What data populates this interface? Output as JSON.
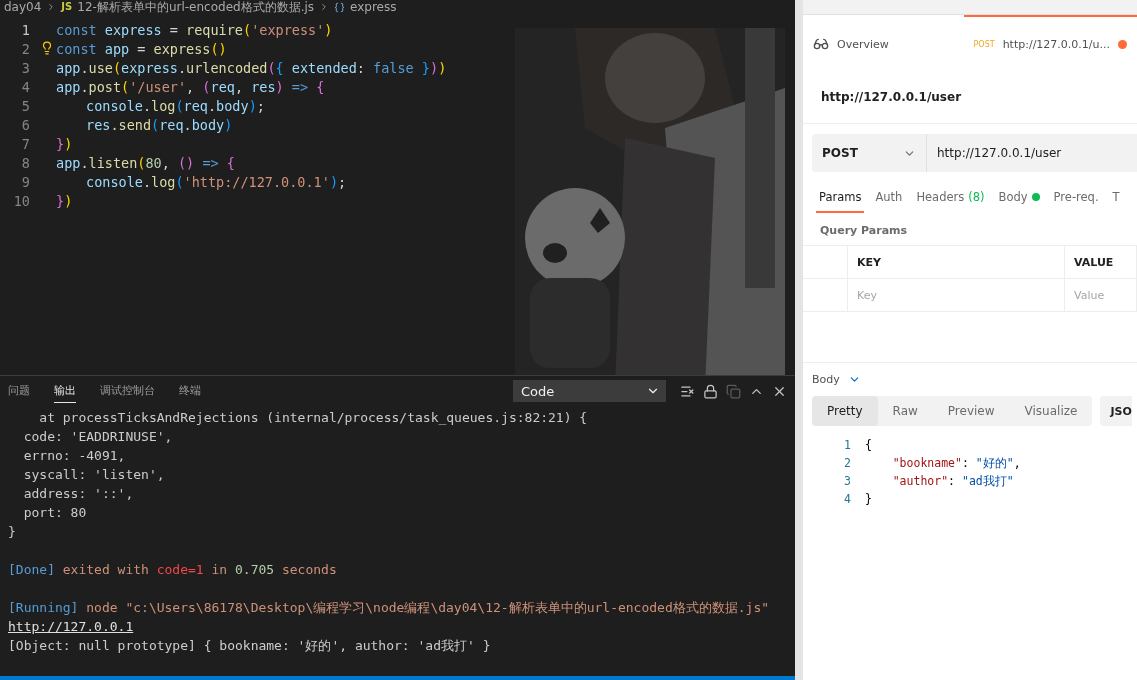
{
  "editor": {
    "breadcrumb": {
      "folder": "day04",
      "file_icon": "JS",
      "file": "12-解析表单中的url-encoded格式的数据.js",
      "symbol": "express"
    },
    "lines": [
      {
        "number": "1",
        "tokens": [
          {
            "text": "const ",
            "kind": "keyword"
          },
          {
            "text": "express",
            "kind": "var"
          },
          {
            "text": " = ",
            "kind": "plain"
          },
          {
            "text": "require",
            "kind": "fn"
          },
          {
            "text": "(",
            "kind": "paren1"
          },
          {
            "text": "'express'",
            "kind": "string"
          },
          {
            "text": ")",
            "kind": "paren1"
          }
        ]
      },
      {
        "number": "2",
        "tokens": [
          {
            "text": "const ",
            "kind": "keyword"
          },
          {
            "text": "app",
            "kind": "var"
          },
          {
            "text": " = ",
            "kind": "plain"
          },
          {
            "text": "express",
            "kind": "fn"
          },
          {
            "text": "()",
            "kind": "paren1"
          }
        ]
      },
      {
        "number": "3",
        "tokens": [
          {
            "text": "app",
            "kind": "var"
          },
          {
            "text": ".",
            "kind": "plain"
          },
          {
            "text": "use",
            "kind": "fn"
          },
          {
            "text": "(",
            "kind": "paren1"
          },
          {
            "text": "express",
            "kind": "var"
          },
          {
            "text": ".",
            "kind": "plain"
          },
          {
            "text": "urlencoded",
            "kind": "fn"
          },
          {
            "text": "(",
            "kind": "paren2"
          },
          {
            "text": "{ ",
            "kind": "paren3"
          },
          {
            "text": "extended",
            "kind": "var"
          },
          {
            "text": ": ",
            "kind": "plain"
          },
          {
            "text": "false",
            "kind": "keyword"
          },
          {
            "text": " }",
            "kind": "paren3"
          },
          {
            "text": ")",
            "kind": "paren2"
          },
          {
            "text": ")",
            "kind": "paren1"
          }
        ]
      },
      {
        "number": "4",
        "tokens": [
          {
            "text": "app",
            "kind": "var"
          },
          {
            "text": ".",
            "kind": "plain"
          },
          {
            "text": "post",
            "kind": "fn"
          },
          {
            "text": "(",
            "kind": "paren1"
          },
          {
            "text": "'/user'",
            "kind": "string"
          },
          {
            "text": ", ",
            "kind": "plain"
          },
          {
            "text": "(",
            "kind": "paren2"
          },
          {
            "text": "req",
            "kind": "var"
          },
          {
            "text": ", ",
            "kind": "plain"
          },
          {
            "text": "res",
            "kind": "var"
          },
          {
            "text": ")",
            "kind": "paren2"
          },
          {
            "text": " => ",
            "kind": "keyword"
          },
          {
            "text": "{",
            "kind": "paren2"
          }
        ]
      },
      {
        "number": "5",
        "indent": true,
        "tokens": [
          {
            "text": "console",
            "kind": "var"
          },
          {
            "text": ".",
            "kind": "plain"
          },
          {
            "text": "log",
            "kind": "fn"
          },
          {
            "text": "(",
            "kind": "paren3"
          },
          {
            "text": "req",
            "kind": "var"
          },
          {
            "text": ".",
            "kind": "plain"
          },
          {
            "text": "body",
            "kind": "var"
          },
          {
            "text": ")",
            "kind": "paren3"
          },
          {
            "text": ";",
            "kind": "plain"
          }
        ]
      },
      {
        "number": "6",
        "indent": true,
        "tokens": [
          {
            "text": "res",
            "kind": "var"
          },
          {
            "text": ".",
            "kind": "plain"
          },
          {
            "text": "send",
            "kind": "fn"
          },
          {
            "text": "(",
            "kind": "paren3"
          },
          {
            "text": "req",
            "kind": "var"
          },
          {
            "text": ".",
            "kind": "plain"
          },
          {
            "text": "body",
            "kind": "var"
          },
          {
            "text": ")",
            "kind": "paren3"
          }
        ]
      },
      {
        "number": "7",
        "tokens": [
          {
            "text": "}",
            "kind": "paren2"
          },
          {
            "text": ")",
            "kind": "paren1"
          }
        ]
      },
      {
        "number": "8",
        "tokens": [
          {
            "text": "app",
            "kind": "var"
          },
          {
            "text": ".",
            "kind": "plain"
          },
          {
            "text": "listen",
            "kind": "fn"
          },
          {
            "text": "(",
            "kind": "paren1"
          },
          {
            "text": "80",
            "kind": "number"
          },
          {
            "text": ", ",
            "kind": "plain"
          },
          {
            "text": "()",
            "kind": "paren2"
          },
          {
            "text": " => ",
            "kind": "keyword"
          },
          {
            "text": "{",
            "kind": "paren2"
          }
        ]
      },
      {
        "number": "9",
        "indent": true,
        "tokens": [
          {
            "text": "console",
            "kind": "var"
          },
          {
            "text": ".",
            "kind": "plain"
          },
          {
            "text": "log",
            "kind": "fn"
          },
          {
            "text": "(",
            "kind": "paren3"
          },
          {
            "text": "'http://127.0.0.1'",
            "kind": "string"
          },
          {
            "text": ")",
            "kind": "paren3"
          },
          {
            "text": ";",
            "kind": "plain"
          }
        ]
      },
      {
        "number": "10",
        "tokens": [
          {
            "text": "}",
            "kind": "paren2"
          },
          {
            "text": ")",
            "kind": "paren1"
          }
        ]
      }
    ]
  },
  "panel": {
    "tabs": [
      {
        "label": "问题",
        "selected": false
      },
      {
        "label": "输出",
        "selected": true
      },
      {
        "label": "调试控制台",
        "selected": false
      },
      {
        "label": "终端",
        "selected": false
      }
    ],
    "channel": "Code",
    "output_blocks": [
      [
        [
          {
            "text": "    at processTicksAndRejections (internal/process/task_queues.js:82:21) {",
            "kind": "plain"
          }
        ],
        [
          {
            "text": "  code: 'EADDRINUSE',",
            "kind": "plain"
          }
        ],
        [
          {
            "text": "  errno: -4091,",
            "kind": "plain"
          }
        ],
        [
          {
            "text": "  syscall: 'listen',",
            "kind": "plain"
          }
        ],
        [
          {
            "text": "  address: '::',",
            "kind": "plain"
          }
        ],
        [
          {
            "text": "  port: 80",
            "kind": "plain"
          }
        ],
        [
          {
            "text": "}",
            "kind": "plain"
          }
        ]
      ],
      [
        [
          {
            "text": "[Done]",
            "kind": "tag"
          },
          {
            "text": " exited with ",
            "kind": "info"
          },
          {
            "text": "code=1",
            "kind": "error"
          },
          {
            "text": " in ",
            "kind": "info"
          },
          {
            "text": "0.705",
            "kind": "number"
          },
          {
            "text": " seconds",
            "kind": "info"
          }
        ]
      ],
      [
        [
          {
            "text": "[Running]",
            "kind": "tag"
          },
          {
            "text": " node \"c:\\Users\\86178\\Desktop\\编程学习\\node编程\\day04\\12-解析表单中的url-encoded格式的数据.js\"",
            "kind": "info"
          }
        ],
        [
          {
            "text": "http://127.0.0.1",
            "kind": "link"
          }
        ],
        [
          {
            "text": "[Object: null prototype] { bookname: '好的', author: 'ad我打' }",
            "kind": "plain"
          }
        ]
      ]
    ]
  },
  "postman": {
    "tabs": [
      {
        "kind": "overview",
        "label": "Overview",
        "selected": false
      },
      {
        "kind": "request",
        "method": "POST",
        "label": "http://127.0.0.1/u...",
        "unsaved": true,
        "selected": true
      }
    ],
    "request_name": "http://127.0.0.1/user",
    "method": "POST",
    "url": "http://127.0.0.1/user",
    "request_tabs": [
      {
        "label": "Params",
        "selected": true
      },
      {
        "label": "Auth",
        "selected": false
      },
      {
        "label": "Headers",
        "count": "(8)",
        "selected": false
      },
      {
        "label": "Body",
        "dot": true,
        "selected": false
      },
      {
        "label": "Pre-req.",
        "selected": false
      },
      {
        "label": "T",
        "selected": false
      }
    ],
    "query_params": {
      "title": "Query Params",
      "columns": [
        "KEY",
        "VALUE"
      ],
      "placeholders": [
        "Key",
        "Value"
      ]
    },
    "response": {
      "label": "Body",
      "views": [
        {
          "label": "Pretty",
          "selected": true
        },
        {
          "label": "Raw",
          "selected": false
        },
        {
          "label": "Preview",
          "selected": false
        },
        {
          "label": "Visualize",
          "selected": false
        }
      ],
      "format": "JSO",
      "lines": [
        {
          "number": "1",
          "tokens": [
            {
              "text": "{",
              "kind": "brace"
            }
          ]
        },
        {
          "number": "2",
          "tokens": [
            {
              "text": "    \"bookname\"",
              "kind": "key"
            },
            {
              "text": ": ",
              "kind": "plain"
            },
            {
              "text": "\"好的\"",
              "kind": "value"
            },
            {
              "text": ",",
              "kind": "plain"
            }
          ]
        },
        {
          "number": "3",
          "tokens": [
            {
              "text": "    \"author\"",
              "kind": "key"
            },
            {
              "text": ": ",
              "kind": "plain"
            },
            {
              "text": "\"ad我打\"",
              "kind": "value"
            }
          ]
        },
        {
          "number": "4",
          "tokens": [
            {
              "text": "}",
              "kind": "brace"
            }
          ]
        }
      ]
    }
  }
}
